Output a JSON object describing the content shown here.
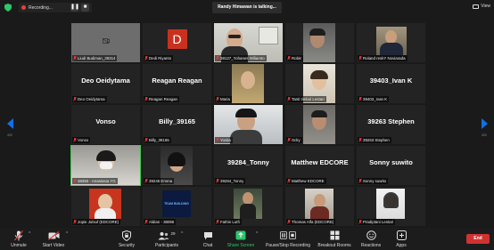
{
  "topbar": {
    "recording_label": "Recording...",
    "pause_glyph": "❚❚",
    "stop_glyph": "■",
    "talking_text": "Randy Himawan is talking...",
    "view_label": "View"
  },
  "pagination": {
    "left_page": "2/2",
    "right_page": "2/2"
  },
  "tiles": [
    {
      "label": "Liudi Budiman_39314",
      "mode": "camoff"
    },
    {
      "label": "Dedi Riyanto",
      "mode": "avatar",
      "avatar": "D"
    },
    {
      "label": "38127_Yohanes Wiliamto",
      "mode": "photo"
    },
    {
      "label": "Robin",
      "mode": "photo"
    },
    {
      "label": "Roland reskY Noviarada",
      "mode": "photo"
    },
    {
      "label": "Deo Oeidytama",
      "mode": "name",
      "name": "Deo Oeidytama"
    },
    {
      "label": "Reagan Reagan",
      "mode": "name",
      "name": "Reagan Reagan"
    },
    {
      "label": "Maria",
      "mode": "photo"
    },
    {
      "label": "Tanti timbul Lestari",
      "mode": "photo"
    },
    {
      "label": "39403_Ivan K",
      "mode": "name",
      "name": "39403_Ivan K"
    },
    {
      "label": "Vonso",
      "mode": "name",
      "name": "Vonso"
    },
    {
      "label": "Billy_39165",
      "mode": "name",
      "name": "Billy_39165"
    },
    {
      "label": "Yovita",
      "mode": "photo"
    },
    {
      "label": "Odry",
      "mode": "photo"
    },
    {
      "label": "39263 Stephen",
      "mode": "name",
      "name": "39263 Stephen"
    },
    {
      "label": "38350 - Anastasia YG",
      "mode": "photo"
    },
    {
      "label": "39246 Emma",
      "mode": "photo"
    },
    {
      "label": "39284_Tonny",
      "mode": "name",
      "name": "39284_Tonny"
    },
    {
      "label": "Matthew EDCORE",
      "mode": "name",
      "name": "Matthew EDCORE"
    },
    {
      "label": "Sonny suwito",
      "mode": "name",
      "name": "Sonny suwito"
    },
    {
      "label": "Jopie Julsuf (EDCORE)",
      "mode": "photo"
    },
    {
      "label": "Aldian - 38096",
      "mode": "photo",
      "logo_text": "TEAM BUILDING"
    },
    {
      "label": "Fathin Lutfi",
      "mode": "photo"
    },
    {
      "label": "Thomas Alfa (EDCORE)",
      "mode": "photo"
    },
    {
      "label": "Pradiptani Lestari",
      "mode": "photo"
    }
  ],
  "toolbar": {
    "unmute": "Unmute",
    "start_video": "Start Video",
    "security": "Security",
    "participants": "Participants",
    "participants_count": "29",
    "chat": "Chat",
    "share_screen": "Share Screen",
    "pause_stop_recording": "Pause/Stop Recording",
    "breakout_rooms": "Breakout Rooms",
    "reactions": "Reactions",
    "apps": "Apps",
    "end": "End"
  },
  "colors": {
    "background": "#1a1a1a",
    "tile": "#232323",
    "accent_blue": "#0e71eb",
    "share_green": "#2ec56c",
    "end_red": "#d03232",
    "mic_red": "#e5403b",
    "avatar_red": "#c9311f",
    "speaking_green": "#3ccf4e"
  }
}
